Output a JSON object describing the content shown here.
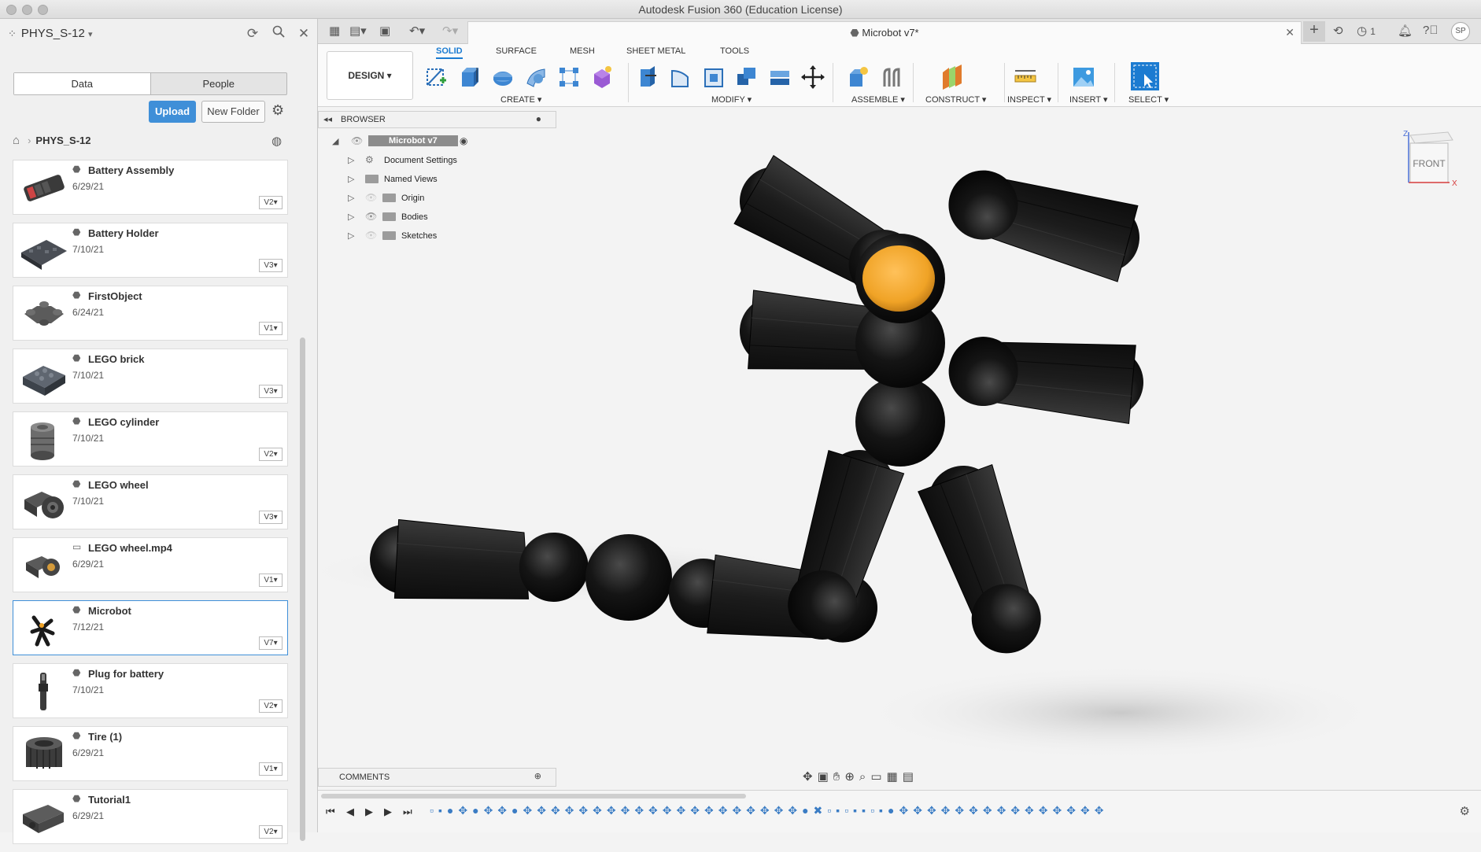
{
  "window": {
    "title": "Autodesk Fusion 360 (Education License)"
  },
  "data_panel": {
    "project": "PHYS_S-12",
    "tabs": [
      "Data",
      "People"
    ],
    "upload_label": "Upload",
    "new_folder_label": "New Folder",
    "breadcrumb": "PHYS_S-12",
    "files": [
      {
        "name": "Battery Assembly",
        "date": "6/29/21",
        "version": "V2"
      },
      {
        "name": "Battery Holder",
        "date": "7/10/21",
        "version": "V3"
      },
      {
        "name": "FirstObject",
        "date": "6/24/21",
        "version": "V1"
      },
      {
        "name": "LEGO brick",
        "date": "7/10/21",
        "version": "V3"
      },
      {
        "name": "LEGO cylinder",
        "date": "7/10/21",
        "version": "V2"
      },
      {
        "name": "LEGO wheel",
        "date": "7/10/21",
        "version": "V3"
      },
      {
        "name": "LEGO wheel.mp4",
        "date": "6/29/21",
        "version": "V1"
      },
      {
        "name": "Microbot",
        "date": "7/12/21",
        "version": "V7"
      },
      {
        "name": "Plug for battery",
        "date": "7/10/21",
        "version": "V2"
      },
      {
        "name": "Tire (1)",
        "date": "6/29/21",
        "version": "V1"
      },
      {
        "name": "Tutorial1",
        "date": "6/29/21",
        "version": "V2"
      }
    ]
  },
  "document_tab": {
    "title": "Microbot v7*",
    "jobs_count": "1",
    "user_initials": "SP"
  },
  "ribbon": {
    "workspace": "DESIGN ▾",
    "tabs": [
      "SOLID",
      "SURFACE",
      "MESH",
      "SHEET METAL",
      "TOOLS"
    ],
    "groups": [
      "CREATE ▾",
      "MODIFY ▾",
      "ASSEMBLE ▾",
      "CONSTRUCT ▾",
      "INSPECT ▾",
      "INSERT ▾",
      "SELECT ▾"
    ]
  },
  "browser": {
    "title": "BROWSER",
    "root": "Microbot v7",
    "items": [
      "Document Settings",
      "Named Views",
      "Origin",
      "Bodies",
      "Sketches"
    ]
  },
  "viewcube": {
    "face": "FRONT",
    "axis_z": "Z",
    "axis_x": "X"
  },
  "comments": {
    "title": "COMMENTS"
  },
  "colors": {
    "accent": "#1b7bd1",
    "upload": "#3f8fd8",
    "highlight_body": "#f0a326",
    "body": "#1c1c1c"
  },
  "icons": [
    "grid-icon",
    "refresh-icon",
    "search-icon",
    "close-icon",
    "gear-icon",
    "home-icon",
    "globe-icon",
    "eye-icon",
    "folder-icon",
    "bell-icon",
    "help-icon",
    "clock-icon"
  ]
}
